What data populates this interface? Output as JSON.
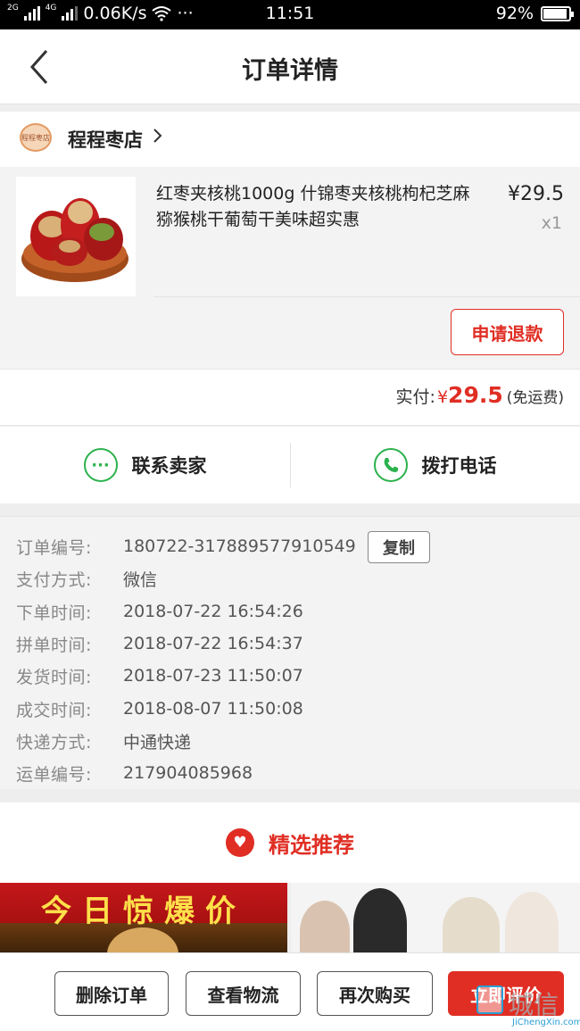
{
  "status_bar": {
    "net_tag_1": "2G",
    "net_tag_2": "4G",
    "speed": "0.06K/s",
    "more": "···",
    "time": "11:51",
    "battery": "92%",
    "battery_level": 0.92
  },
  "header": {
    "title": "订单详情"
  },
  "shop": {
    "logo_text": "程程枣店",
    "name": "程程枣店"
  },
  "product": {
    "title": "红枣夹核桃1000g 什锦枣夹核桃枸杞芝麻猕猴桃干葡萄干美味超实惠",
    "price": "¥29.5",
    "quantity": "x1",
    "refund_label": "申请退款"
  },
  "payment": {
    "label": "实付:",
    "currency": "¥",
    "amount": "29.5",
    "note": "(免运费)"
  },
  "contact": {
    "seller_label": "联系卖家",
    "phone_label": "拨打电话"
  },
  "order_info": {
    "copy_label": "复制",
    "rows": [
      {
        "label": "订单编号:",
        "value": "180722-317889577910549"
      },
      {
        "label": "支付方式:",
        "value": "微信"
      },
      {
        "label": "下单时间:",
        "value": "2018-07-22 16:54:26"
      },
      {
        "label": "拼单时间:",
        "value": "2018-07-22 16:54:37"
      },
      {
        "label": "发货时间:",
        "value": "2018-07-23 11:50:07"
      },
      {
        "label": "成交时间:",
        "value": "2018-08-07 11:50:08"
      },
      {
        "label": "快递方式:",
        "value": "中通快递"
      },
      {
        "label": "运单编号:",
        "value": "217904085968"
      }
    ]
  },
  "recommend": {
    "title": "精选推荐",
    "banner_left_text": "今日惊爆价"
  },
  "bottom_bar": {
    "delete_label": "删除订单",
    "logistics_label": "查看物流",
    "rebuy_label": "再次购买",
    "review_label": "立即评价"
  },
  "watermark": {
    "text": "城信",
    "url": "JiChengXin.com"
  },
  "colors": {
    "accent": "#e02e24",
    "contact_green": "#2bb24c"
  }
}
